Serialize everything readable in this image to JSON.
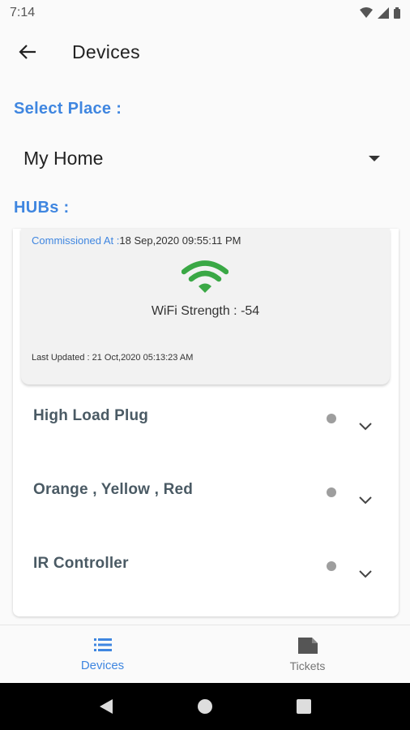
{
  "status_bar": {
    "time": "7:14"
  },
  "app_bar": {
    "title": "Devices"
  },
  "place": {
    "label": "Select Place :",
    "selected": "My Home"
  },
  "hubs": {
    "label": "HUBs :",
    "hub": {
      "commissioned_label": "Commissioned At :",
      "commissioned_value": "18 Sep,2020 09:55:11 PM",
      "wifi_strength": "WiFi Strength : -54",
      "last_updated": "Last Updated : 21 Oct,2020 05:13:23 AM"
    }
  },
  "devices": [
    {
      "name": "High Load Plug"
    },
    {
      "name": "Orange , Yellow , Red"
    },
    {
      "name": "IR Controller"
    }
  ],
  "bottom_nav": {
    "items": [
      {
        "label": "Devices",
        "icon": "list-icon",
        "active": true
      },
      {
        "label": "Tickets",
        "icon": "ticket-icon",
        "active": false
      }
    ]
  },
  "colors": {
    "accent": "#3f86e0",
    "wifi_green": "#3aa845",
    "status_dot": "#9e9e9e",
    "device_text": "#4a5a64"
  }
}
